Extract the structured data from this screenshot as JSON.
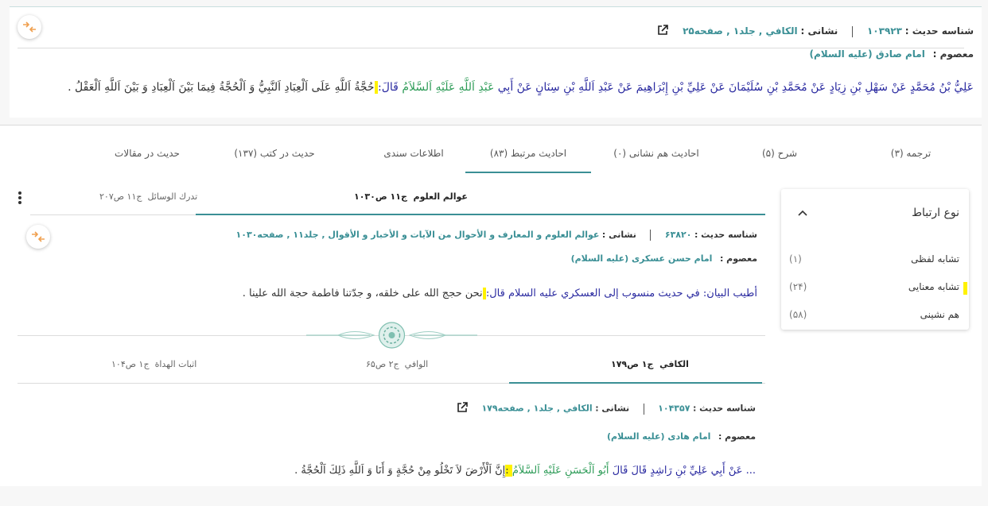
{
  "top_hadith": {
    "id_label": "شناسه حدیث :",
    "id_value": "۱۰۳۹۲۳",
    "address_label": "نشانی :",
    "address_value": "الکافي , جلد۱ , صفحه۲۵",
    "masoom_label": "معصوم :",
    "masoom_value": "امام صادق (علیه السلام)",
    "text_sanad": "عَلِيُّ بْنُ مُحَمَّدٍ عَنْ سَهْلِ بْنِ زِيَادٍ عَنْ مُحَمَّدِ بْنِ سُلَيْمَانَ عَنْ عَلِيِّ بْنِ إِبْرَاهِيمَ عَنْ عَبْدِ اَللَّهِ بْنِ سِنَانٍ عَنْ أَبِي",
    "text_imam": "عَبْدِ اَللَّهِ عَلَيْهِ اَلسَّلاَمُ",
    "text_qal": "قَالَ:",
    "text_matn": "حُجَّةُ اَللَّهِ عَلَى اَلْعِبَادِ اَلنَّبِيُّ وَ اَلْحُجَّةُ فِيمَا بَيْنَ اَلْعِبَادِ وَ بَيْنَ اَللَّهِ اَلْعَقْلُ ."
  },
  "tabs": [
    {
      "label": "ترجمه (۳)"
    },
    {
      "label": "شرح (۵)"
    },
    {
      "label": "احادیث هم نشانی (۰)"
    },
    {
      "label": "احادیث مرتبط (۸۳)"
    },
    {
      "label": "اطلاعات سندی"
    },
    {
      "label": "حدیث در کتب (۱۳۷)"
    },
    {
      "label": "حدیث در مقالات"
    }
  ],
  "filter": {
    "title": "نوع ارتباط",
    "items": [
      {
        "label": "تشابه لفظی",
        "count": "(۱)"
      },
      {
        "label": "تشابه معنایی",
        "count": "(۲۴)"
      },
      {
        "label": "هم نشینی",
        "count": "(۵۸)"
      }
    ]
  },
  "related1": {
    "subtabs": [
      {
        "book": "عوالم العلوم",
        "ref": "ج۱۱ ص۱۰۳۰"
      },
      {
        "book": "تدرك الوسائل",
        "ref": "ج۱۱ ص۲۰۷"
      }
    ],
    "id_label": "شناسه حدیث :",
    "id_value": "۶۳۸۲۰",
    "address_label": "نشانی :",
    "address_value": "عوالم العلوم و المعارف و الأحوال من الآيات و الأخبار و الأقوال , جلد۱۱ , صفحه۱۰۳۰",
    "masoom_label": "معصوم :",
    "masoom_value": "امام حسن عسکری (علیه السلام)",
    "text_intro": "أطيب البيان: في حديث منسوب إلى العسكري عليه السلام قال:",
    "text_matn": "نحن حجج الله على خلقه، و جدّتنا فاطمة حجة الله علينا ."
  },
  "related2": {
    "subtabs": [
      {
        "book": "الکافي",
        "ref": "ج۱ ص۱۷۹"
      },
      {
        "book": "الوافي",
        "ref": "ج۲ ص۶۵"
      },
      {
        "book": "اثبات الهداة",
        "ref": "ج۱ ص۱۰۴"
      }
    ],
    "id_label": "شناسه حدیث :",
    "id_value": "۱۰۴۳۵۷",
    "address_label": "نشانی :",
    "address_value": "الکافي , جلد۱ , صفحه۱۷۹",
    "masoom_label": "معصوم :",
    "masoom_value": "امام هادی (علیه السلام)",
    "text_sanad": "... عَنْ أَبِي عَلِيِّ بْنِ رَاشِدٍ قَالَ قَالَ",
    "text_imam": "أَبُو اَلْحَسَنِ عَلَيْهِ اَلسَّلاَمُ",
    "text_matn": "إِنَّ اَلْأَرْضَ لاَ تَخْلُو مِنْ حُجَّةٍ وَ أَنَا وَ اَللَّهِ ذَلِكَ اَلْحُجَّةُ ."
  },
  "colors": {
    "accent": "#3a8f95",
    "narrator": "#2a2aa0",
    "imam": "#2e9c58",
    "highlight": "#fff200",
    "compare_icon": "#f0a050"
  }
}
